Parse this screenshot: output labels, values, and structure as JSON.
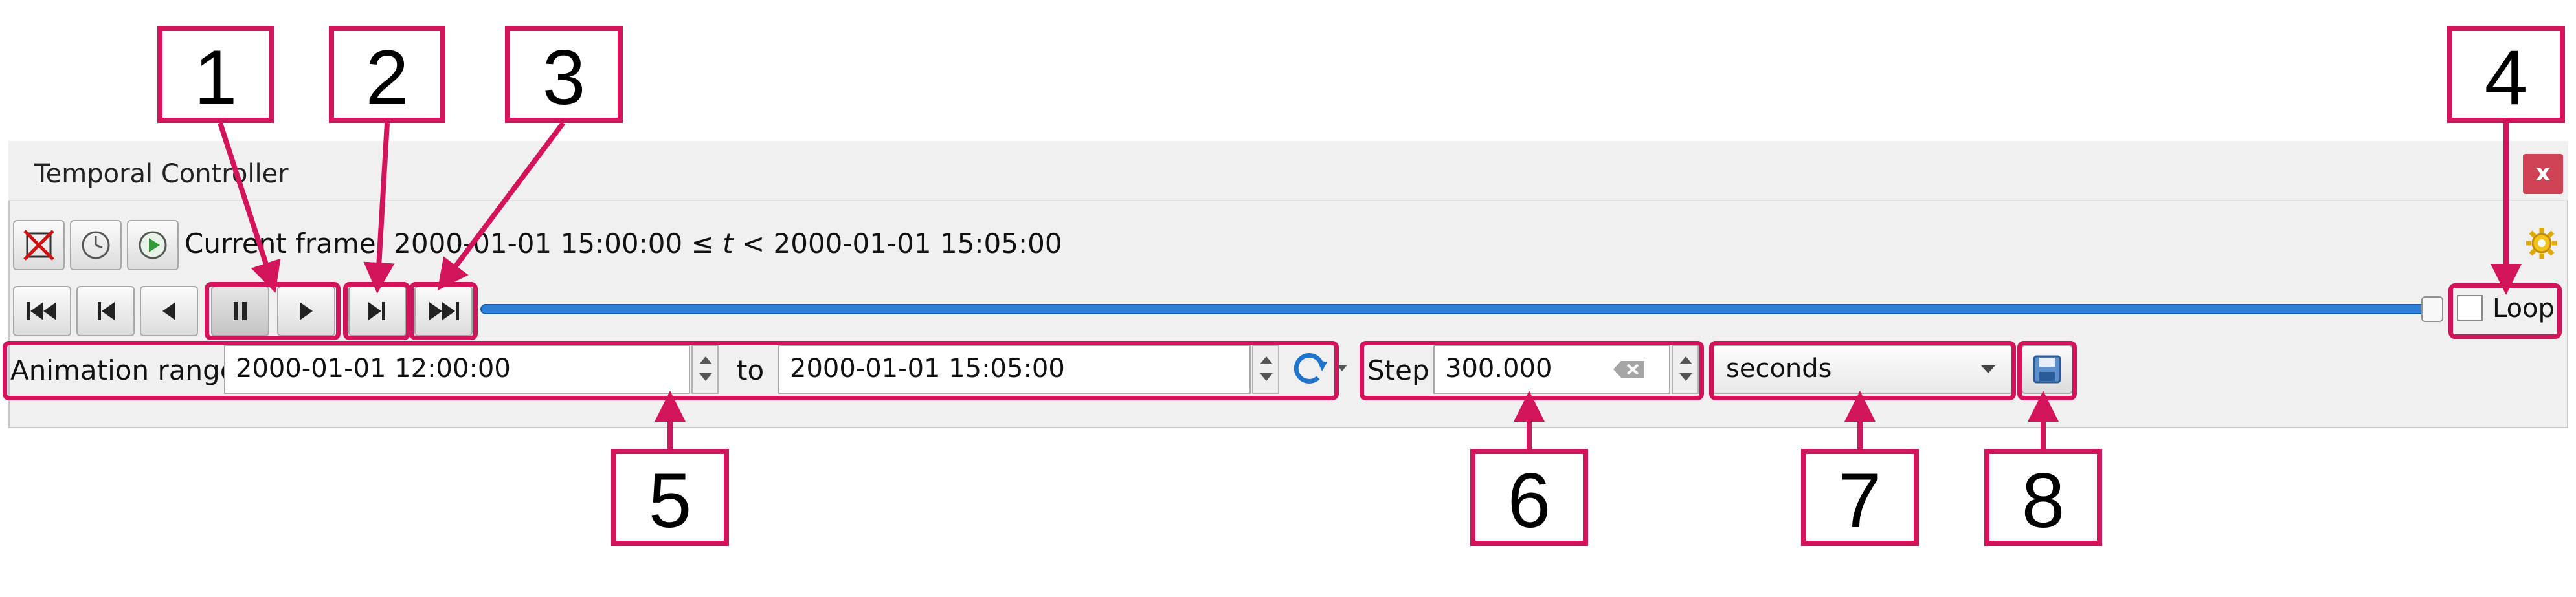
{
  "window": {
    "title": "Temporal Controller",
    "close_label": "x"
  },
  "toolbar": {
    "icons": [
      "disable-navigation-icon",
      "fixed-range-icon",
      "animated-navigation-icon",
      "settings-icon"
    ]
  },
  "current_frame": {
    "prefix": "Current frame: ",
    "start": "2000-01-01 15:00:00",
    "operator": " ≤ ",
    "variable": "t",
    "lt": " < ",
    "end": "2000-01-01 15:05:00"
  },
  "playback": {
    "buttons": [
      "rewind-to-start",
      "skip-back",
      "play-backward",
      "pause",
      "play-forward",
      "skip-forward",
      "skip-to-end"
    ],
    "slider_fraction": 1.0,
    "loop_label": "Loop",
    "loop_checked": false
  },
  "range": {
    "label": "Animation range",
    "start": "2000-01-01 12:00:00",
    "to_label": "to",
    "end": "2000-01-01 15:05:00"
  },
  "step": {
    "label": "Step",
    "value": "300.000",
    "unit": "seconds"
  },
  "callouts": [
    "1",
    "2",
    "3",
    "4",
    "5",
    "6",
    "7",
    "8"
  ],
  "colors": {
    "accent": "#d4145a",
    "slider": "#2e7fd6",
    "close": "#cf4255"
  }
}
